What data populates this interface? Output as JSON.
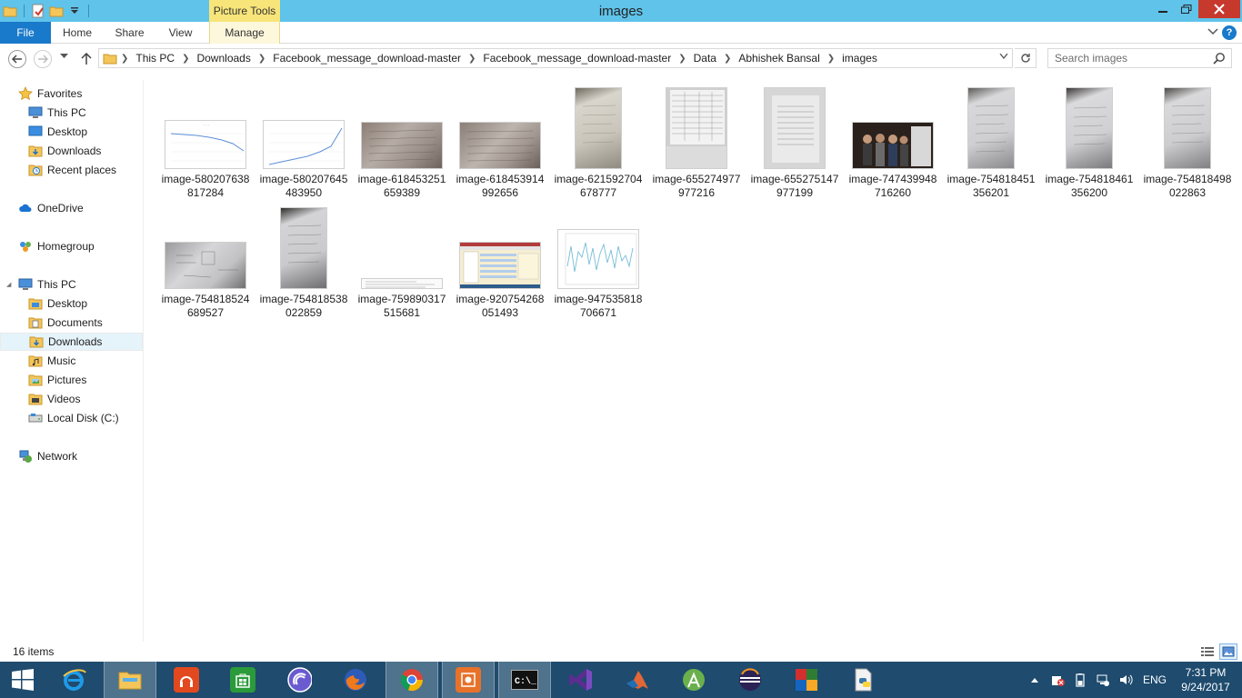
{
  "window": {
    "title": "images",
    "context_tab_group": "Picture Tools"
  },
  "ribbon": {
    "tabs": [
      "File",
      "Home",
      "Share",
      "View",
      "Manage"
    ]
  },
  "address": {
    "crumbs": [
      "This PC",
      "Downloads",
      "Facebook_message_download-master",
      "Facebook_message_download-master",
      "Data",
      "Abhishek Bansal",
      "images"
    ]
  },
  "search": {
    "placeholder": "Search images"
  },
  "nav": {
    "favorites": "Favorites",
    "fav_items": [
      "This PC",
      "Desktop",
      "Downloads",
      "Recent places"
    ],
    "onedrive": "OneDrive",
    "homegroup": "Homegroup",
    "thispc": "This PC",
    "pc_items": [
      "Desktop",
      "Documents",
      "Downloads",
      "Music",
      "Pictures",
      "Videos",
      "Local Disk (C:)"
    ],
    "network": "Network"
  },
  "files": [
    {
      "line1": "image-580207638",
      "line2": "817284",
      "kind": "chart-down"
    },
    {
      "line1": "image-580207645",
      "line2": "483950",
      "kind": "chart-up"
    },
    {
      "line1": "image-618453251",
      "line2": "659389",
      "kind": "photo-notes"
    },
    {
      "line1": "image-618453914",
      "line2": "992656",
      "kind": "photo-notes"
    },
    {
      "line1": "image-621592704",
      "line2": "678777",
      "kind": "paper-tall"
    },
    {
      "line1": "image-655274977",
      "line2": "977216",
      "kind": "paper-table"
    },
    {
      "line1": "image-655275147",
      "line2": "977199",
      "kind": "paper-table2"
    },
    {
      "line1": "image-747439948",
      "line2": "716260",
      "kind": "people"
    },
    {
      "line1": "image-754818451",
      "line2": "356201",
      "kind": "paper-tall"
    },
    {
      "line1": "image-754818461",
      "line2": "356200",
      "kind": "paper-tall"
    },
    {
      "line1": "image-754818498",
      "line2": "022863",
      "kind": "paper-tall"
    },
    {
      "line1": "image-754818524",
      "line2": "689527",
      "kind": "photo-diagram"
    },
    {
      "line1": "image-754818538",
      "line2": "022859",
      "kind": "paper-tall"
    },
    {
      "line1": "image-759890317",
      "line2": "515681",
      "kind": "text-strip"
    },
    {
      "line1": "image-920754268",
      "line2": "051493",
      "kind": "spreadsheet"
    },
    {
      "line1": "image-947535818",
      "line2": "706671",
      "kind": "chart-noisy"
    }
  ],
  "status": {
    "item_count": "16 items"
  },
  "taskbar": {
    "apps": [
      "internet-explorer",
      "file-explorer",
      "music-app",
      "windows-store",
      "bittorrent",
      "firefox",
      "chrome",
      "screen-recorder",
      "command-prompt",
      "visual-studio",
      "matlab",
      "android-studio",
      "eclipse",
      "winrar",
      "python-file"
    ],
    "language": "ENG",
    "time": "7:31 PM",
    "date": "9/24/2017"
  },
  "colors": {
    "titlebar": "#5fc3ea",
    "context_tab": "#f8e57a",
    "file_tab": "#1979ca",
    "close_button": "#c7382d",
    "taskbar": "#1e4b6e",
    "selection": "#e5f3fb"
  }
}
